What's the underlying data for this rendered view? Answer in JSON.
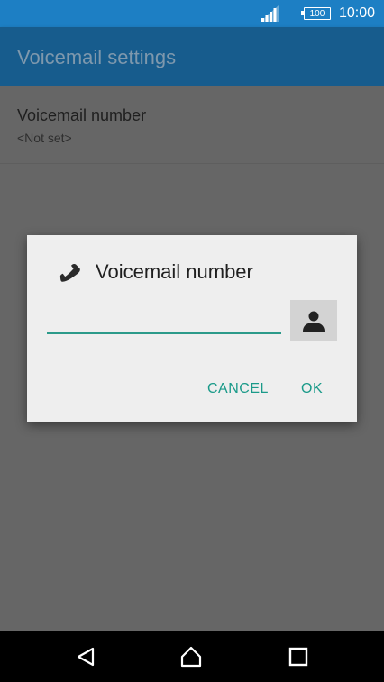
{
  "status_bar": {
    "battery_level": "100",
    "time": "10:00",
    "icons": [
      "signal-icon",
      "battery-icon"
    ]
  },
  "app_bar": {
    "title": "Voicemail settings"
  },
  "preference": {
    "title": "Voicemail number",
    "summary": "<Not set>"
  },
  "dialog": {
    "title": "Voicemail number",
    "icon": "phone-handset-icon",
    "input_value": "",
    "contact_icon": "contact-person-icon",
    "cancel_label": "CANCEL",
    "ok_label": "OK"
  },
  "nav_bar": {
    "icons": [
      "back-icon",
      "home-icon",
      "recents-icon"
    ]
  },
  "colors": {
    "status_bar": "#1d7fc4",
    "app_bar": "#175c8d",
    "accent": "#1a9a89",
    "scrim": "#666666"
  }
}
